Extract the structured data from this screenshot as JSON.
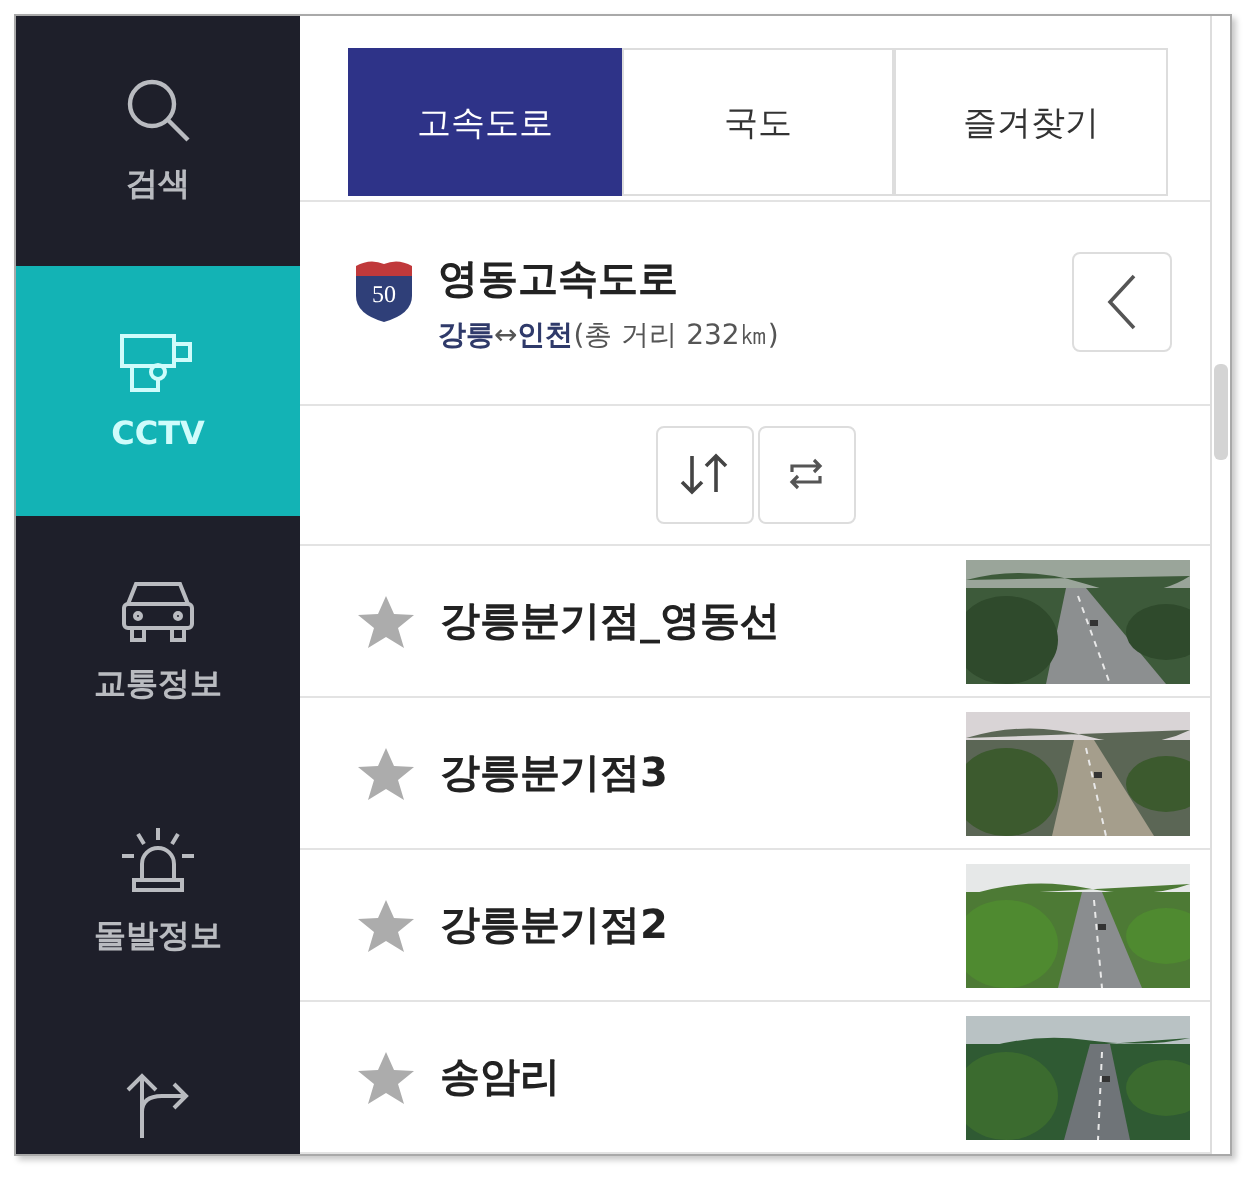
{
  "sidebar": {
    "items": [
      {
        "kind": "search",
        "label": "검색",
        "selected": false
      },
      {
        "kind": "cctv",
        "label": "CCTV",
        "selected": true
      },
      {
        "kind": "car",
        "label": "교통정보",
        "selected": false
      },
      {
        "kind": "alert",
        "label": "돌발정보",
        "selected": false
      },
      {
        "kind": "route",
        "selected": false
      }
    ]
  },
  "tabs": [
    {
      "label": "고속도로",
      "selected": true
    },
    {
      "label": "국도",
      "selected": false
    },
    {
      "label": "즐겨찾기",
      "selected": false
    }
  ],
  "road": {
    "number": "50",
    "name": "영동고속도로",
    "from": "강릉",
    "arrow": "↔",
    "to": "인천",
    "distance": "(총 거리 232㎞)"
  },
  "cameras": [
    {
      "name": "강릉분기점_영동선",
      "starred": false
    },
    {
      "name": "강릉분기점3",
      "starred": false
    },
    {
      "name": "강릉분기점2",
      "starred": false
    },
    {
      "name": "송암리",
      "starred": false
    }
  ]
}
